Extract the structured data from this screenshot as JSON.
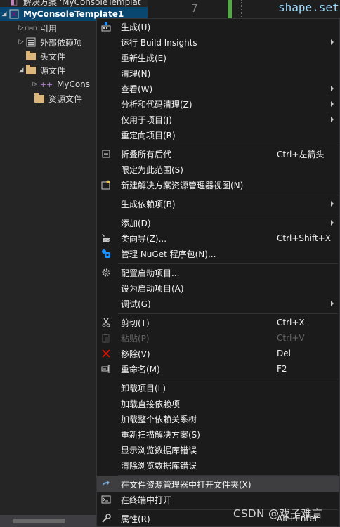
{
  "solution_explorer": {
    "solution_row": "解决方案 'MyConsoleTemplat",
    "items": [
      {
        "label": "MyConsoleTemplate1",
        "icon": "project-icon"
      },
      {
        "label": "引用",
        "icon": "references-icon"
      },
      {
        "label": "外部依赖项",
        "icon": "external-deps-icon"
      },
      {
        "label": "头文件",
        "icon": "folder-icon"
      },
      {
        "label": "源文件",
        "icon": "folder-icon"
      },
      {
        "label": "MyCons",
        "icon": "cpp-file-icon",
        "prefix": "++"
      },
      {
        "label": "资源文件",
        "icon": "folder-icon"
      }
    ]
  },
  "editor": {
    "line_number": "7",
    "code": "shape.set"
  },
  "context_menu": {
    "items": [
      {
        "label": "生成(U)",
        "shortcut": "",
        "icon": "build-icon",
        "submenu": false
      },
      {
        "label": "运行 Build Insights",
        "shortcut": "",
        "icon": "",
        "submenu": true
      },
      {
        "label": "重新生成(E)",
        "shortcut": "",
        "icon": "",
        "submenu": false
      },
      {
        "label": "清理(N)",
        "shortcut": "",
        "icon": "",
        "submenu": false
      },
      {
        "label": "查看(W)",
        "shortcut": "",
        "icon": "",
        "submenu": true
      },
      {
        "label": "分析和代码清理(Z)",
        "shortcut": "",
        "icon": "",
        "submenu": true
      },
      {
        "label": "仅用于项目(J)",
        "shortcut": "",
        "icon": "",
        "submenu": true
      },
      {
        "label": "重定向项目(R)",
        "shortcut": "",
        "icon": "",
        "submenu": false
      },
      {
        "label": "折叠所有后代",
        "shortcut": "Ctrl+左箭头",
        "icon": "collapse-icon",
        "submenu": false
      },
      {
        "label": "限定为此范围(S)",
        "shortcut": "",
        "icon": "",
        "submenu": false
      },
      {
        "label": "新建解决方案资源管理器视图(N)",
        "shortcut": "",
        "icon": "new-view-icon",
        "submenu": false
      },
      {
        "label": "生成依赖项(B)",
        "shortcut": "",
        "icon": "",
        "submenu": true
      },
      {
        "label": "添加(D)",
        "shortcut": "",
        "icon": "",
        "submenu": true
      },
      {
        "label": "类向导(Z)...",
        "shortcut": "Ctrl+Shift+X",
        "icon": "class-wizard-icon",
        "submenu": false
      },
      {
        "label": "管理 NuGet 程序包(N)...",
        "shortcut": "",
        "icon": "nuget-icon",
        "submenu": false
      },
      {
        "label": "配置启动项目...",
        "shortcut": "",
        "icon": "gear-icon",
        "submenu": false
      },
      {
        "label": "设为启动项目(A)",
        "shortcut": "",
        "icon": "",
        "submenu": false
      },
      {
        "label": "调试(G)",
        "shortcut": "",
        "icon": "",
        "submenu": true
      },
      {
        "label": "剪切(T)",
        "shortcut": "Ctrl+X",
        "icon": "scissors-icon",
        "submenu": false
      },
      {
        "label": "粘贴(P)",
        "shortcut": "Ctrl+V",
        "icon": "paste-icon",
        "submenu": false,
        "disabled": true
      },
      {
        "label": "移除(V)",
        "shortcut": "Del",
        "icon": "remove-icon",
        "submenu": false
      },
      {
        "label": "重命名(M)",
        "shortcut": "F2",
        "icon": "rename-icon",
        "submenu": false
      },
      {
        "label": "卸载项目(L)",
        "shortcut": "",
        "icon": "",
        "submenu": false
      },
      {
        "label": "加载直接依赖项",
        "shortcut": "",
        "icon": "",
        "submenu": false
      },
      {
        "label": "加载整个依赖关系树",
        "shortcut": "",
        "icon": "",
        "submenu": false
      },
      {
        "label": "重新扫描解决方案(S)",
        "shortcut": "",
        "icon": "",
        "submenu": false
      },
      {
        "label": "显示浏览数据库错误",
        "shortcut": "",
        "icon": "",
        "submenu": false
      },
      {
        "label": "清除浏览数据库错误",
        "shortcut": "",
        "icon": "",
        "submenu": false
      },
      {
        "label": "在文件资源管理器中打开文件夹(X)",
        "shortcut": "",
        "icon": "open-folder-icon",
        "submenu": false,
        "hover": true
      },
      {
        "label": "在终端中打开",
        "shortcut": "",
        "icon": "terminal-icon",
        "submenu": false
      },
      {
        "label": "属性(R)",
        "shortcut": "Alt+Enter",
        "icon": "wrench-icon",
        "submenu": false
      }
    ]
  },
  "watermark": "CSDN @戏子难言",
  "colors": {
    "menu_bg": "#1b1b1c",
    "selection": "#094771",
    "hover": "#3e3e40",
    "remove_red": "#e51400",
    "nuget_blue": "#1e90ff"
  }
}
